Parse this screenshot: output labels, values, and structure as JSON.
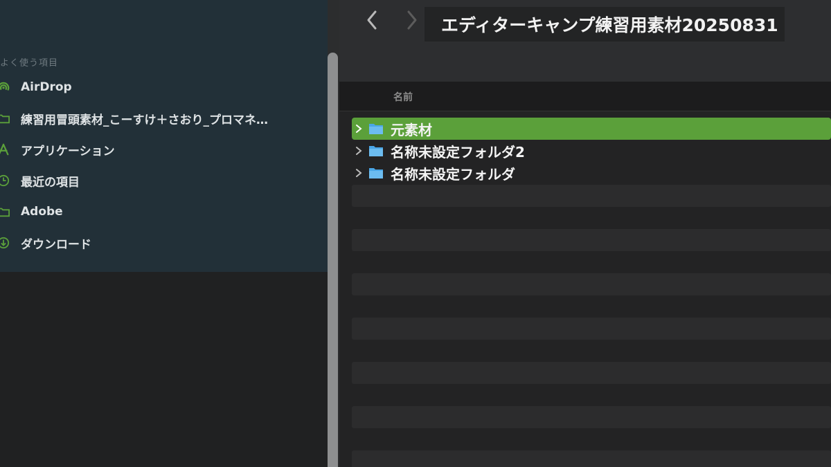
{
  "sidebar": {
    "section_title": "よく使う項目",
    "items": [
      {
        "label": "AirDrop",
        "icon": "airdrop-icon"
      },
      {
        "label": "練習用冒頭素材_こーすけ＋さおり_プロマネ…",
        "icon": "folder-icon"
      },
      {
        "label": "アプリケーション",
        "icon": "applications-icon"
      },
      {
        "label": "最近の項目",
        "icon": "clock-icon"
      },
      {
        "label": "Adobe",
        "icon": "folder-icon"
      },
      {
        "label": "ダウンロード",
        "icon": "download-icon"
      }
    ]
  },
  "toolbar": {
    "back_icon": "chevron-left-icon",
    "forward_icon": "chevron-right-icon",
    "title": "エディターキャンプ練習用素材20250831"
  },
  "list": {
    "column_name": "名前",
    "items": [
      {
        "name": "元素材",
        "selected": true
      },
      {
        "name": "名称未設定フォルダ2",
        "selected": false
      },
      {
        "name": "名称未設定フォルダ",
        "selected": false
      }
    ]
  },
  "colors": {
    "accent": "#5ba03a",
    "sidebar_icon": "#5ba03a",
    "folder": "#4aa6e6"
  }
}
